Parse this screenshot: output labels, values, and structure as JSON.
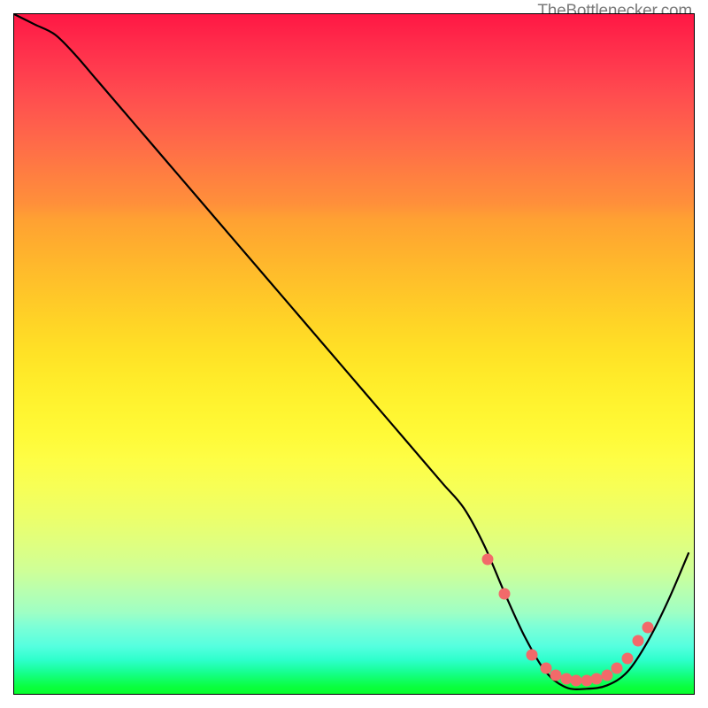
{
  "watermark": "TheBottlenecker.com",
  "chart_data": {
    "type": "line",
    "title": "",
    "xlabel": "",
    "ylabel": "",
    "xlim": [
      0,
      100
    ],
    "ylim": [
      0,
      100
    ],
    "series": [
      {
        "name": "bottleneck-curve",
        "x": [
          0,
          3,
          6,
          9,
          12,
          15,
          18,
          21,
          24,
          27,
          30,
          33,
          36,
          39,
          42,
          45,
          48,
          51,
          54,
          57,
          60,
          63,
          66,
          69,
          72,
          75,
          78,
          81,
          84,
          87,
          90,
          93,
          96,
          99
        ],
        "y_pct": [
          100,
          98.5,
          97,
          94,
          90.5,
          87,
          83.5,
          80,
          76.5,
          73,
          69.5,
          66,
          62.5,
          59,
          55.5,
          52,
          48.5,
          45,
          41.5,
          38,
          34.5,
          31,
          27.5,
          22,
          15,
          8.5,
          3.5,
          1.2,
          1,
          1.5,
          3.5,
          8,
          14,
          21
        ]
      }
    ],
    "markers": {
      "name": "highlight-dots",
      "points": [
        {
          "x": 69.5,
          "y_pct": 20
        },
        {
          "x": 72,
          "y_pct": 15
        },
        {
          "x": 76,
          "y_pct": 6
        },
        {
          "x": 78,
          "y_pct": 4
        },
        {
          "x": 79.5,
          "y_pct": 3
        },
        {
          "x": 81,
          "y_pct": 2.5
        },
        {
          "x": 82.5,
          "y_pct": 2.2
        },
        {
          "x": 84,
          "y_pct": 2.2
        },
        {
          "x": 85.5,
          "y_pct": 2.5
        },
        {
          "x": 87,
          "y_pct": 3
        },
        {
          "x": 88.5,
          "y_pct": 4
        },
        {
          "x": 90,
          "y_pct": 5.5
        },
        {
          "x": 91.5,
          "y_pct": 8
        },
        {
          "x": 93,
          "y_pct": 10
        }
      ]
    },
    "gradient_stops": [
      {
        "pct": 0,
        "color": "#ff1744"
      },
      {
        "pct": 50,
        "color": "#ffe226"
      },
      {
        "pct": 100,
        "color": "#08ff2c"
      }
    ]
  }
}
